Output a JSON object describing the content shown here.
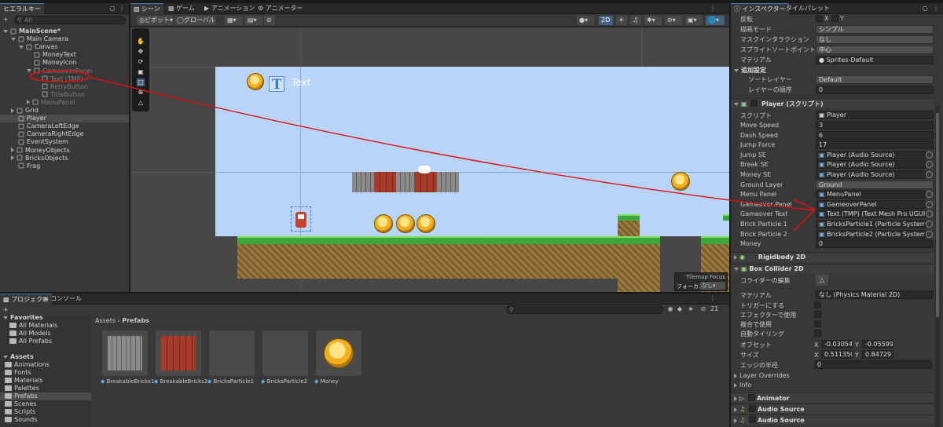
{
  "hierarchy": {
    "tab": "ヒエラルキー",
    "search_placeholder": "All",
    "add": "+",
    "items": [
      {
        "label": "MainScene*",
        "indent": 0
      },
      {
        "label": "Main Camera",
        "indent": 1
      },
      {
        "label": "Canvas",
        "indent": 2
      },
      {
        "label": "MoneyText",
        "indent": 3
      },
      {
        "label": "MoneyIcon",
        "indent": 3
      },
      {
        "label": "GameoverPanel",
        "indent": 3
      },
      {
        "label": "Text (TMP)",
        "indent": 4
      },
      {
        "label": "RetryButton",
        "indent": 4
      },
      {
        "label": "TitleButton",
        "indent": 4
      },
      {
        "label": "MenuPanel",
        "indent": 3
      },
      {
        "label": "Grid",
        "indent": 1
      },
      {
        "label": "Player",
        "indent": 1
      },
      {
        "label": "CameraLeftEdge",
        "indent": 1
      },
      {
        "label": "CameraRightEdge",
        "indent": 1
      },
      {
        "label": "EventSystem",
        "indent": 1
      },
      {
        "label": "MoneyObjects",
        "indent": 1
      },
      {
        "label": "BricksObjects",
        "indent": 1
      },
      {
        "label": "Frag",
        "indent": 1
      }
    ]
  },
  "scene": {
    "tabs": [
      "シーン",
      "ゲーム",
      "アニメーション",
      "アニメーター"
    ],
    "pivot": "ピボット",
    "global": "グローバル",
    "mode2d": "2D",
    "canvas_text": "Text",
    "tilemap_focus": "Tilemap Focus",
    "focus_label": "フォーカス",
    "focus_value": "なし"
  },
  "project": {
    "tabs": [
      "プロジェクト",
      "コンソール"
    ],
    "add": "+",
    "breadcrumb_root": "Assets",
    "breadcrumb_sep": "›",
    "breadcrumb_leaf": "Prefabs",
    "count": "21",
    "favorites": {
      "title": "Favorites",
      "items": [
        "All Materials",
        "All Models",
        "All Prefabs"
      ]
    },
    "assets": {
      "title": "Assets",
      "items": [
        "Animations",
        "Fonts",
        "Materials",
        "Palettes",
        "Prefabs",
        "Scenes",
        "Scripts",
        "Sounds"
      ]
    },
    "prefabs": [
      "BreakableBricks1",
      "BreakableBricks2",
      "BricksParticle1",
      "BricksParticle2",
      "Money"
    ]
  },
  "inspector": {
    "tabs": [
      "インスペクター",
      "タイルパレット"
    ],
    "flip": {
      "label": "反転",
      "x": "X",
      "y": "Y"
    },
    "draw_mode": {
      "label": "描画モード",
      "value": "シンプル"
    },
    "mask": {
      "label": "マスクインタラクション",
      "value": "なし"
    },
    "sort_point": {
      "label": "スプライトソートポイント",
      "value": "中心"
    },
    "material": {
      "label": "マテリアル",
      "value": "Sprites-Default"
    },
    "additional": "追加設定",
    "sorting_layer": {
      "label": "ソートレイヤー",
      "value": "Default"
    },
    "order": {
      "label": "レイヤーの順序",
      "value": "0"
    },
    "player": {
      "title": "Player (スクリプト)",
      "script_label": "スクリプト",
      "script_value": "Player",
      "fields": [
        {
          "label": "Move Speed",
          "value": "3",
          "kind": "text"
        },
        {
          "label": "Dash Speed",
          "value": "6",
          "kind": "text"
        },
        {
          "label": "Jump Force",
          "value": "17",
          "kind": "text"
        },
        {
          "label": "Jump SE",
          "value": "Player (Audio Source)",
          "kind": "obj"
        },
        {
          "label": "Break SE",
          "value": "Player (Audio Source)",
          "kind": "obj"
        },
        {
          "label": "Money SE",
          "value": "Player (Audio Source)",
          "kind": "obj"
        },
        {
          "label": "Ground Layer",
          "value": "Ground",
          "kind": "drop"
        },
        {
          "label": "Menu Panel",
          "value": "MenuPanel",
          "kind": "obj"
        },
        {
          "label": "Gameover Panel",
          "value": "GameoverPanel",
          "kind": "obj"
        },
        {
          "label": "Gameover Text",
          "value": "Text (TMP) (Text Mesh Pro UGUI)",
          "kind": "obj"
        },
        {
          "label": "Brick Particle 1",
          "value": "BricksParticle1 (Particle System)",
          "kind": "obj"
        },
        {
          "label": "Brick Particle 2",
          "value": "BricksParticle2 (Particle System)",
          "kind": "obj"
        },
        {
          "label": "Money",
          "value": "0",
          "kind": "text"
        }
      ]
    },
    "rigidbody": "Rigidbody 2D",
    "boxcollider": {
      "title": "Box Collider 2D",
      "edit": "コライダーの編集",
      "material_label": "マテリアル",
      "material_value": "なし (Physics Material 2D)",
      "trigger": "トリガーにする",
      "effector": "エフェクターで使用",
      "composite": "複合で使用",
      "autotile": "自動タイリング",
      "offset": "オフセット",
      "offset_x": "-0.030540",
      "offset_y": "-0.055991",
      "size": "サイズ",
      "size_x": "0.5113508",
      "size_y": "0.8472971",
      "edge": "エッジの半径",
      "edge_value": "0",
      "overrides": "Layer Overrides",
      "info": "Info"
    },
    "animator": "Animator",
    "audio1": "Audio Source",
    "audio2": "Audio Source"
  },
  "colors": {
    "accent": "#3a79bb",
    "annotation": "#e01010",
    "sky": "#b8d4f8",
    "grass": "#3aa83a"
  }
}
